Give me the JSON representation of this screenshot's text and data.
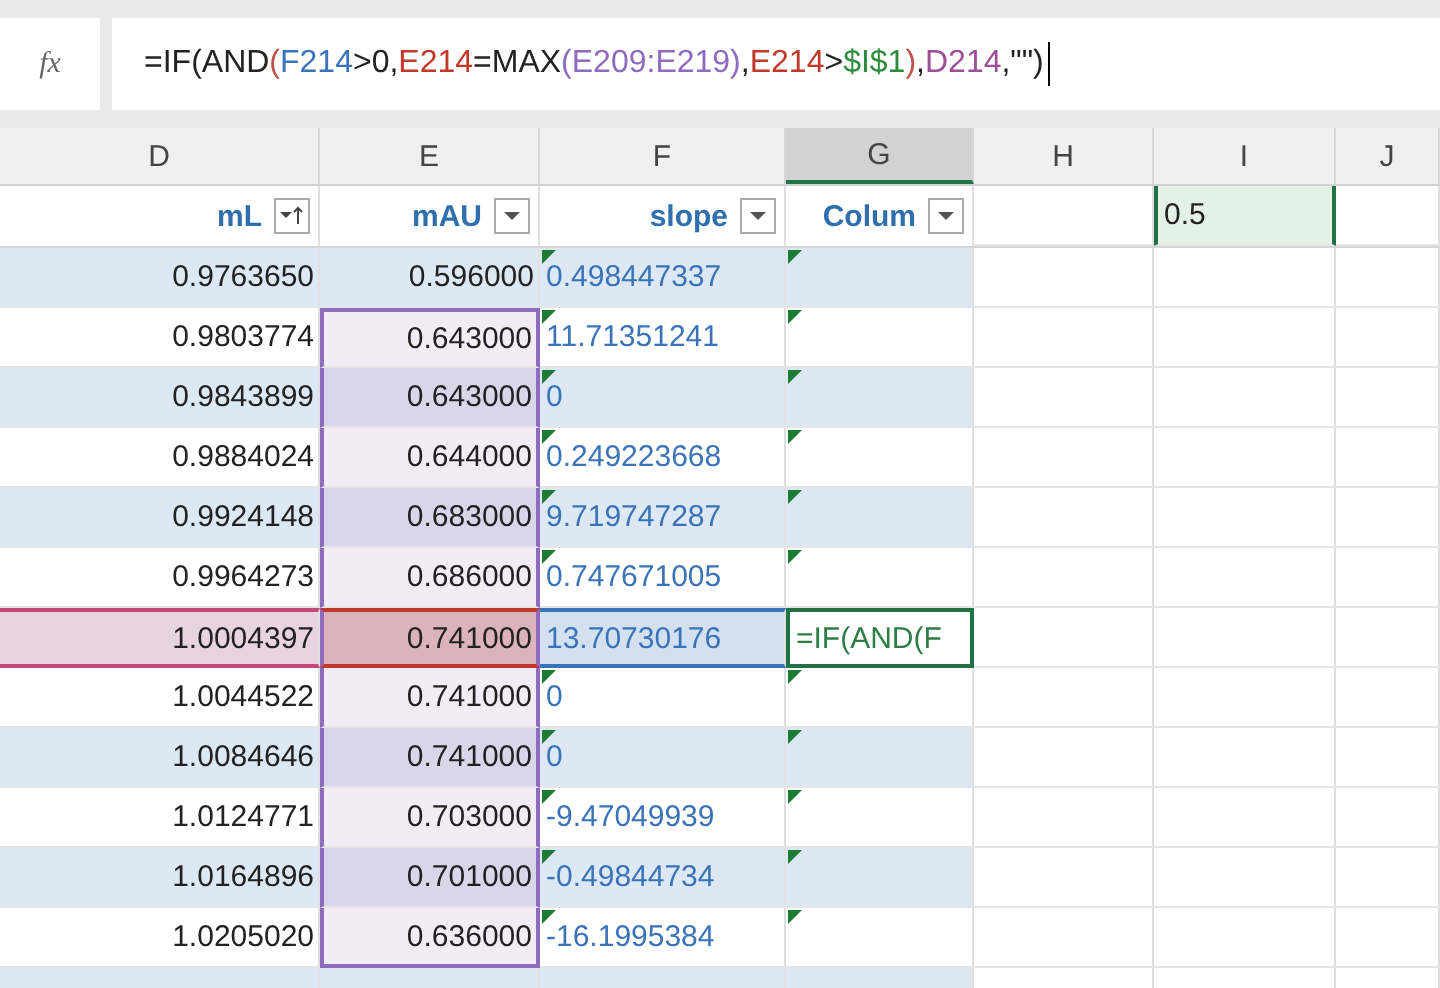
{
  "formula_bar": {
    "fx": "fx",
    "formula": [
      {
        "text": "=IF(AND",
        "color": "#222222"
      },
      {
        "text": "(",
        "color": "#c0504d"
      },
      {
        "text": "F214",
        "color": "#3b73b9"
      },
      {
        "text": ">0,",
        "color": "#222222"
      },
      {
        "text": "E214",
        "color": "#c0392b"
      },
      {
        "text": "=MAX",
        "color": "#222222"
      },
      {
        "text": "(E209:E219)",
        "color": "#8e6bbf"
      },
      {
        "text": ",",
        "color": "#222222"
      },
      {
        "text": "E214",
        "color": "#c0392b"
      },
      {
        "text": ">",
        "color": "#222222"
      },
      {
        "text": "$I$1",
        "color": "#2e8b3e"
      },
      {
        "text": ")",
        "color": "#c0504d"
      },
      {
        "text": ",",
        "color": "#222222"
      },
      {
        "text": "D214",
        "color": "#9b4f96"
      },
      {
        "text": ",\"\")",
        "color": "#222222"
      }
    ]
  },
  "column_headers": [
    {
      "label": "D",
      "selected": false
    },
    {
      "label": "E",
      "selected": false
    },
    {
      "label": "F",
      "selected": false
    },
    {
      "label": "G",
      "selected": true
    },
    {
      "label": "H",
      "selected": false
    },
    {
      "label": "I",
      "selected": false
    },
    {
      "label": "J",
      "selected": false
    }
  ],
  "table_header": [
    {
      "label": "mL",
      "sorted": true
    },
    {
      "label": "mAU",
      "sorted": false
    },
    {
      "label": "slope",
      "sorted": false
    },
    {
      "label": "Colum",
      "sorted": false
    }
  ],
  "i1_value": "0.5",
  "rows": [
    {
      "d": "0.9763650",
      "e": "0.596000",
      "f": "0.498447337",
      "referenced": false,
      "selected": false
    },
    {
      "d": "0.9803774",
      "e": "0.643000",
      "f": "11.71351241",
      "referenced": true,
      "selected": false
    },
    {
      "d": "0.9843899",
      "e": "0.643000",
      "f": "0",
      "referenced": true,
      "selected": false
    },
    {
      "d": "0.9884024",
      "e": "0.644000",
      "f": "0.249223668",
      "referenced": true,
      "selected": false
    },
    {
      "d": "0.9924148",
      "e": "0.683000",
      "f": "9.719747287",
      "referenced": true,
      "selected": false
    },
    {
      "d": "0.9964273",
      "e": "0.686000",
      "f": "0.747671005",
      "referenced": true,
      "selected": false
    },
    {
      "d": "1.0004397",
      "e": "0.741000",
      "f": "13.70730176",
      "g": "=IF(AND(F",
      "referenced": true,
      "selected": true
    },
    {
      "d": "1.0044522",
      "e": "0.741000",
      "f": "0",
      "referenced": true,
      "selected": false
    },
    {
      "d": "1.0084646",
      "e": "0.741000",
      "f": "0",
      "referenced": true,
      "selected": false
    },
    {
      "d": "1.0124771",
      "e": "0.703000",
      "f": "-9.47049939",
      "referenced": true,
      "selected": false
    },
    {
      "d": "1.0164896",
      "e": "0.701000",
      "f": "-0.49844734",
      "referenced": true,
      "selected": false
    },
    {
      "d": "1.0205020",
      "e": "0.636000",
      "f": "-16.1995384",
      "referenced": true,
      "selected": false
    }
  ]
}
